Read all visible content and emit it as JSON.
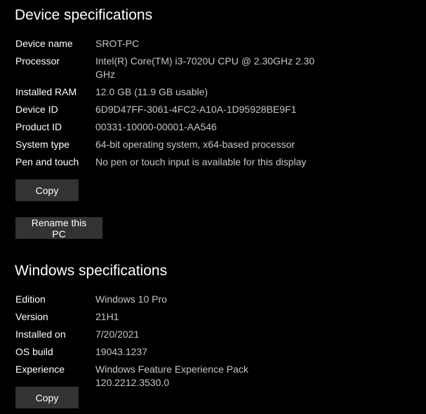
{
  "device_specs": {
    "title": "Device specifications",
    "rows": [
      {
        "label": "Device name",
        "value": "SROT-PC"
      },
      {
        "label": "Processor",
        "value": "Intel(R) Core(TM) i3-7020U CPU @ 2.30GHz   2.30 GHz"
      },
      {
        "label": "Installed RAM",
        "value": "12.0 GB (11.9 GB usable)"
      },
      {
        "label": "Device ID",
        "value": "6D9D47FF-3061-4FC2-A10A-1D95928BE9F1"
      },
      {
        "label": "Product ID",
        "value": "00331-10000-00001-AA546"
      },
      {
        "label": "System type",
        "value": "64-bit operating system, x64-based processor"
      },
      {
        "label": "Pen and touch",
        "value": "No pen or touch input is available for this display"
      }
    ],
    "copy_label": "Copy",
    "rename_label": "Rename this PC"
  },
  "windows_specs": {
    "title": "Windows specifications",
    "rows": [
      {
        "label": "Edition",
        "value": "Windows 10 Pro"
      },
      {
        "label": "Version",
        "value": "21H1"
      },
      {
        "label": "Installed on",
        "value": "7/20/2021"
      },
      {
        "label": "OS build",
        "value": "19043.1237"
      },
      {
        "label": "Experience",
        "value": "Windows Feature Experience Pack 120.2212.3530.0"
      }
    ],
    "copy_label": "Copy"
  }
}
